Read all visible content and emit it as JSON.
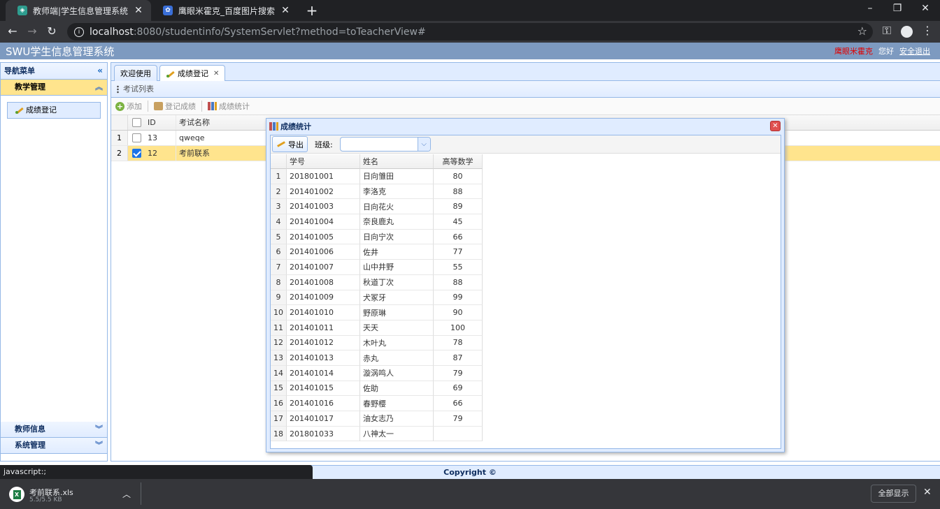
{
  "browser": {
    "tabs": [
      {
        "title": "教师端|学生信息管理系统",
        "active": true
      },
      {
        "title": "鹰眼米霍克_百度图片搜索",
        "active": false
      }
    ],
    "url_host": "localhost",
    "url_rest": ":8080/studentinfo/SystemServlet?method=toTeacherView#"
  },
  "app": {
    "title": "SWU学生信息管理系统",
    "user_name": "鹰眼米霍克",
    "greeting": "您好",
    "logout": "安全退出"
  },
  "sidebar": {
    "header": "导航菜单",
    "sections": [
      {
        "label": "教学管理",
        "active": true,
        "items": [
          {
            "label": "成绩登记"
          }
        ]
      },
      {
        "label": "教师信息",
        "active": false
      },
      {
        "label": "系统管理",
        "active": false
      }
    ]
  },
  "tabs": [
    {
      "label": "欢迎使用"
    },
    {
      "label": "成绩登记",
      "closable": true
    }
  ],
  "exam_panel": {
    "title": "考试列表",
    "toolbar": {
      "add": "添加",
      "register": "登记成绩",
      "stats": "成绩统计"
    },
    "columns": [
      "ID",
      "考试名称"
    ],
    "rows": [
      {
        "n": "1",
        "id": "13",
        "name": "qweqe",
        "checked": false
      },
      {
        "n": "2",
        "id": "12",
        "name": "考前联系",
        "checked": true
      }
    ]
  },
  "dialog": {
    "title": "成绩统计",
    "export_label": "导出",
    "class_label": "班级:",
    "class_value": "",
    "columns": [
      "学号",
      "姓名",
      "高等数学"
    ],
    "rows": [
      {
        "n": "1",
        "sid": "201801001",
        "name": "日向雏田",
        "math": "80"
      },
      {
        "n": "2",
        "sid": "201401002",
        "name": "李洛克",
        "math": "88"
      },
      {
        "n": "3",
        "sid": "201401003",
        "name": "日向花火",
        "math": "89"
      },
      {
        "n": "4",
        "sid": "201401004",
        "name": "奈良鹿丸",
        "math": "45"
      },
      {
        "n": "5",
        "sid": "201401005",
        "name": "日向宁次",
        "math": "66"
      },
      {
        "n": "6",
        "sid": "201401006",
        "name": "佐井",
        "math": "77"
      },
      {
        "n": "7",
        "sid": "201401007",
        "name": "山中井野",
        "math": "55"
      },
      {
        "n": "8",
        "sid": "201401008",
        "name": "秋道丁次",
        "math": "88"
      },
      {
        "n": "9",
        "sid": "201401009",
        "name": "犬冢牙",
        "math": "99"
      },
      {
        "n": "10",
        "sid": "201401010",
        "name": "野原琳",
        "math": "90"
      },
      {
        "n": "11",
        "sid": "201401011",
        "name": "天天",
        "math": "100"
      },
      {
        "n": "12",
        "sid": "201401012",
        "name": "木叶丸",
        "math": "78"
      },
      {
        "n": "13",
        "sid": "201401013",
        "name": "赤丸",
        "math": "87"
      },
      {
        "n": "14",
        "sid": "201401014",
        "name": "漩涡鸣人",
        "math": "79"
      },
      {
        "n": "15",
        "sid": "201401015",
        "name": "佐助",
        "math": "69"
      },
      {
        "n": "16",
        "sid": "201401016",
        "name": "春野樱",
        "math": "66"
      },
      {
        "n": "17",
        "sid": "201401017",
        "name": "油女志乃",
        "math": "79"
      },
      {
        "n": "18",
        "sid": "201801033",
        "name": "八神太一",
        "math": ""
      }
    ]
  },
  "footer": "Copyright ©",
  "status_text": "javascript:;",
  "download": {
    "filename": "考前联系.xls",
    "size": "5.5/5.5 KB",
    "show_all": "全部显示"
  }
}
